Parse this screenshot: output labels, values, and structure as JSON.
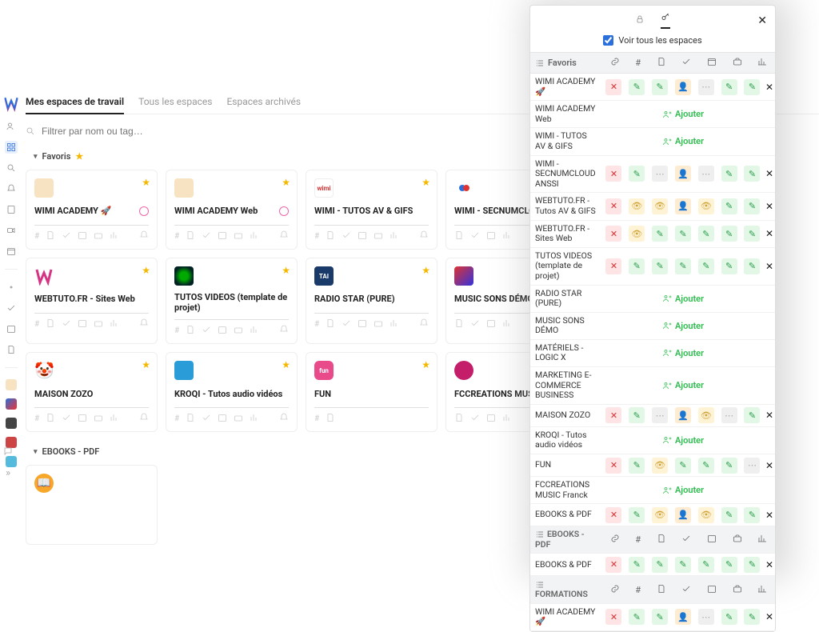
{
  "tabs": {
    "my_spaces": "Mes espaces de travail",
    "all_spaces": "Tous les espaces",
    "archived": "Espaces archivés"
  },
  "filter_placeholder": "Filtrer par nom ou tag…",
  "sections": {
    "favoris": "Favoris",
    "ebooks": "EBOOKS - PDF"
  },
  "cards": [
    {
      "title": "WIMI ACADEMY 🚀",
      "sub": "ring"
    },
    {
      "title": "WIMI ACADEMY Web",
      "sub": "ring"
    },
    {
      "title": "WIMI - TUTOS AV & GIFS"
    },
    {
      "title": "WIMI - SECNUMCLOUD"
    },
    {
      "title": "WEBTUTO.FR - Sites Web"
    },
    {
      "title": "TUTOS VIDEOS (template de projet)"
    },
    {
      "title": "RADIO STAR (PURE)"
    },
    {
      "title": "MUSIC SONS DÉMO MAT"
    },
    {
      "title": "MAISON ZOZO"
    },
    {
      "title": "KROQI - Tutos audio vidéos"
    },
    {
      "title": "FUN"
    },
    {
      "title": "FCCREATIONS MUSIC F"
    }
  ],
  "overlay": {
    "show_all_label": "Voir tous les espaces",
    "header_label": "Favoris",
    "add_label": "Ajouter",
    "rows": [
      {
        "label": "WIMI ACADEMY 🚀",
        "type": "perm",
        "cells": [
          "red",
          "green",
          "green",
          "orange",
          "gray",
          "green",
          "green"
        ],
        "x": true
      },
      {
        "label": "WIMI ACADEMY Web",
        "type": "add"
      },
      {
        "label": "WIMI - TUTOS AV & GIFS",
        "type": "add"
      },
      {
        "label": "WIMI - SECNUMCLOUD ANSSI",
        "type": "perm",
        "cells": [
          "red",
          "green",
          "gray",
          "orange",
          "gray",
          "green",
          "green"
        ],
        "x": true
      },
      {
        "label": "WEBTUTO.FR - Tutos AV & GIFS",
        "type": "perm",
        "cells": [
          "red",
          "yellow",
          "yellow",
          "orange",
          "yellow",
          "green",
          "green"
        ],
        "x": true
      },
      {
        "label": "WEBTUTO.FR - Sites Web",
        "type": "perm",
        "cells": [
          "red",
          "yellow",
          "green",
          "green",
          "green",
          "green",
          "green"
        ],
        "x": true
      },
      {
        "label": "TUTOS VIDEOS (template de projet)",
        "type": "perm",
        "cells": [
          "red",
          "green",
          "green",
          "green",
          "green",
          "green",
          "green"
        ],
        "x": true
      },
      {
        "label": "RADIO STAR (PURE)",
        "type": "add"
      },
      {
        "label": "MUSIC SONS DÉMO",
        "type": "add"
      },
      {
        "label": "MATÉRIELS - LOGIC X",
        "type": "add"
      },
      {
        "label": "MARKETING E-COMMERCE BUSINESS",
        "type": "add"
      },
      {
        "label": "MAISON ZOZO",
        "type": "perm",
        "cells": [
          "red",
          "green",
          "gray",
          "orange",
          "yellow",
          "gray",
          "green"
        ],
        "x": true
      },
      {
        "label": "KROQI - Tutos audio vidéos",
        "type": "add"
      },
      {
        "label": "FUN",
        "type": "perm",
        "cells": [
          "red",
          "green",
          "yellow",
          "green",
          "green",
          "green",
          "gray"
        ],
        "x": true
      },
      {
        "label": "FCCREATIONS MUSIC Franck",
        "type": "add"
      },
      {
        "label": "EBOOKS & PDF",
        "type": "perm",
        "cells": [
          "red",
          "green",
          "yellow",
          "orange",
          "yellow",
          "green",
          "green"
        ],
        "x": true
      },
      {
        "label": "EBOOKS - PDF",
        "type": "section"
      },
      {
        "label": "EBOOKS & PDF",
        "type": "perm",
        "cells": [
          "red",
          "green",
          "green",
          "green",
          "green",
          "green",
          "green"
        ],
        "x": true
      },
      {
        "label": "FORMATIONS",
        "type": "section"
      },
      {
        "label": "WIMI ACADEMY 🚀",
        "type": "perm",
        "cells": [
          "red",
          "green",
          "green",
          "orange",
          "gray",
          "green",
          "green"
        ],
        "x": true
      }
    ]
  }
}
